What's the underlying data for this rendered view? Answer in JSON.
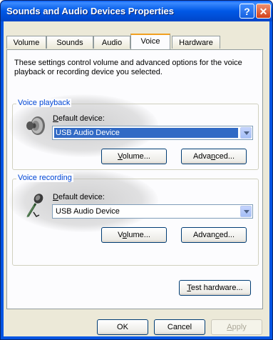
{
  "window": {
    "title": "Sounds and Audio Devices Properties",
    "help_label": "?",
    "close_label": "✕"
  },
  "tabs": [
    {
      "label": "Volume"
    },
    {
      "label": "Sounds"
    },
    {
      "label": "Audio"
    },
    {
      "label": "Voice",
      "active": true
    },
    {
      "label": "Hardware"
    }
  ],
  "intro": "These settings control volume and advanced options for the voice playback or recording device you selected.",
  "playback": {
    "title": "Voice playback",
    "icon": "speaker-icon",
    "device_label_pre": "",
    "device_label_key": "D",
    "device_label_post": "efault device:",
    "device_value": "USB Audio Device",
    "volume_key": "V",
    "volume_rest": "olume...",
    "advanced_pre": "Adva",
    "advanced_key": "n",
    "advanced_post": "ced..."
  },
  "recording": {
    "title": "Voice recording",
    "icon": "microphone-icon",
    "device_label_key": "D",
    "device_label_post": "efault device:",
    "device_value": "USB Audio Device",
    "volume_pre": "V",
    "volume_key": "o",
    "volume_post": "lume...",
    "advanced_pre": "Advan",
    "advanced_key": "c",
    "advanced_post": "ed..."
  },
  "test_hw": {
    "key": "T",
    "rest": "est hardware..."
  },
  "footer": {
    "ok": "OK",
    "cancel": "Cancel",
    "apply_key": "A",
    "apply_rest": "pply"
  },
  "colors": {
    "titlebar": "#0054e3",
    "face": "#ece9d8",
    "group_title": "#0046d5",
    "selection": "#316ac5"
  }
}
